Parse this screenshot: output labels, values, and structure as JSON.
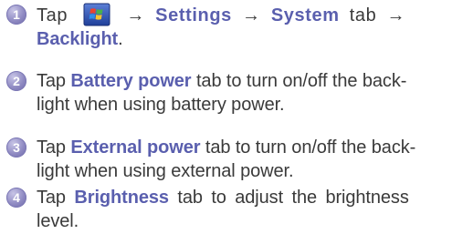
{
  "steps": [
    {
      "number": "1",
      "line1_prefix": "Tap",
      "icon": "windows-start-icon",
      "arrow1": "→",
      "settings": "Settings",
      "arrow2": "→",
      "system": "System",
      "tab_word": "tab",
      "arrow3": "→",
      "backlight": "Backlight",
      "period": "."
    },
    {
      "number": "2",
      "prefix": "Tap",
      "keyword": "Battery power",
      "rest_line1": "tab to turn on/off the back-",
      "rest_line2": "light when using battery power."
    },
    {
      "number": "3",
      "prefix": "Tap",
      "keyword": "External power",
      "rest_line1": "tab to turn on/off the back-",
      "rest_line2": "light when using external power."
    },
    {
      "number": "4",
      "prefix": "Tap",
      "keyword": "Brightness",
      "rest_line1": "tab to adjust the brightness",
      "rest_line2": "level."
    }
  ],
  "colors": {
    "keyword": "#5a5fae",
    "body_text": "#3a3a3a",
    "badge": "#8f8ac2"
  }
}
